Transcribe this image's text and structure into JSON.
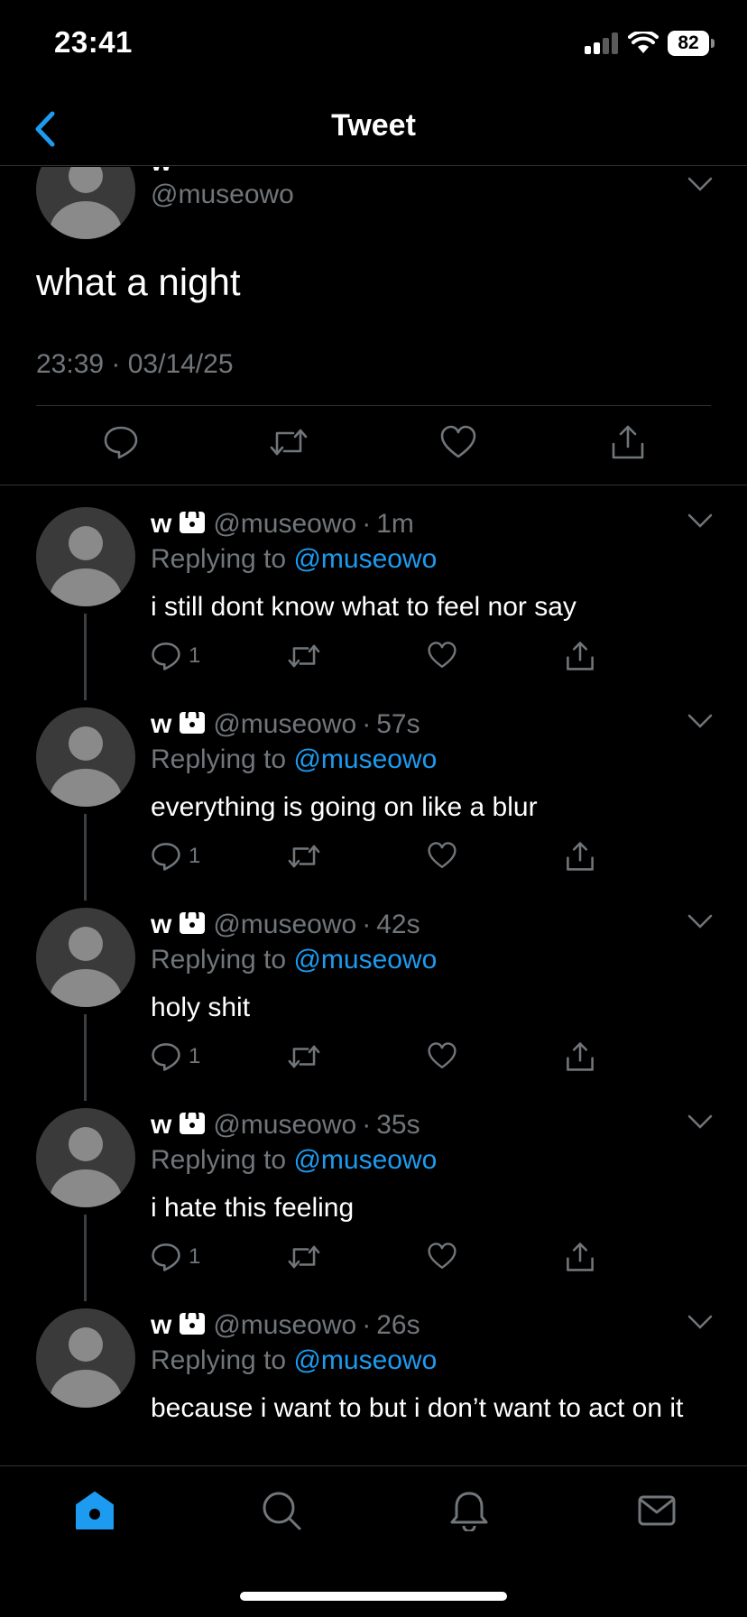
{
  "status_bar": {
    "time": "23:41",
    "battery": "82"
  },
  "nav": {
    "title": "Tweet"
  },
  "main_tweet": {
    "name": "w",
    "handle": "@museowo",
    "text": "what a night",
    "timestamp": "23:39 · 03/14/25"
  },
  "replies": [
    {
      "name": "w",
      "handle": "@museowo",
      "time": "1m",
      "replying_prefix": "Replying to",
      "replying_to": "@museowo",
      "text": "i still dont know what to feel nor say",
      "reply_count": "1"
    },
    {
      "name": "w",
      "handle": "@museowo",
      "time": "57s",
      "replying_prefix": "Replying to",
      "replying_to": "@museowo",
      "text": "everything is going on like a blur",
      "reply_count": "1"
    },
    {
      "name": "w",
      "handle": "@museowo",
      "time": "42s",
      "replying_prefix": "Replying to",
      "replying_to": "@museowo",
      "text": "holy shit",
      "reply_count": "1"
    },
    {
      "name": "w",
      "handle": "@museowo",
      "time": "35s",
      "replying_prefix": "Replying to",
      "replying_to": "@museowo",
      "text": "i hate this feeling",
      "reply_count": "1"
    },
    {
      "name": "w",
      "handle": "@museowo",
      "time": "26s",
      "replying_prefix": "Replying to",
      "replying_to": "@museowo",
      "text": "because i want to but i don’t want to act on it",
      "reply_count": ""
    }
  ],
  "tabs": [
    "home-icon",
    "search-icon",
    "bell-icon",
    "mail-icon"
  ],
  "colors": {
    "accent": "#1d9bf0",
    "muted": "#71767b",
    "background": "#000000",
    "divider": "#2f3336"
  }
}
